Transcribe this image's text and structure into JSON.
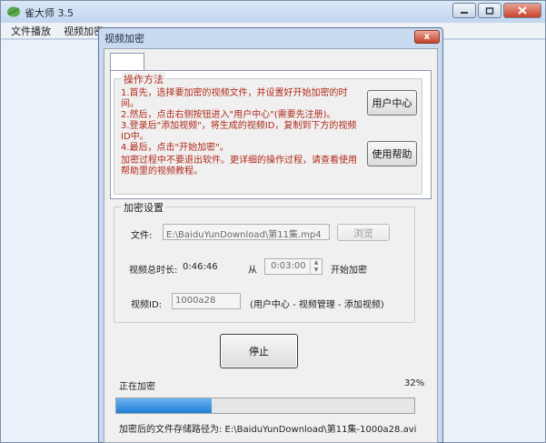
{
  "app": {
    "title": "雀大师 3.5",
    "icon": "leaf-icon",
    "window_buttons": [
      "minimize",
      "maximize",
      "close"
    ]
  },
  "menu": {
    "items": [
      "文件播放",
      "视频加密"
    ]
  },
  "dialog": {
    "title": "视频加密",
    "close_glyph": "x"
  },
  "howto": {
    "title": "操作方法",
    "steps": [
      "1.首先，选择要加密的视频文件，并设置好开始加密的时间。",
      "2.然后，点击右侧按钮进入\"用户中心\"(需要先注册)。",
      "3.登录后\"添加视频\"，将生成的视频ID，复制到下方的视频ID中。",
      "4.最后，点击\"开始加密\"。"
    ],
    "note": "加密过程中不要退出软件。更详细的操作过程，请查看使用帮助里的视频教程。",
    "user_center_label": "用户中心",
    "help_label": "使用帮助"
  },
  "settings": {
    "title": "加密设置",
    "file_label": "文件:",
    "file_value": "E:\\BaiduYunDownload\\第11集.mp4",
    "browse_label": "浏览",
    "duration_label": "视频总时长:",
    "duration_value": "0:46:46",
    "from_label": "从",
    "start_time": "0:03:00",
    "start_label": "开始加密",
    "video_id_label": "视频ID:",
    "video_id_value": "1000a28",
    "video_id_hint": "(用户中心 - 视频管理 - 添加视频)"
  },
  "actions": {
    "stop_label": "停止"
  },
  "status": {
    "label": "正在加密",
    "percent_text": "32%",
    "progress_fraction": 0.32,
    "output_path": "加密后的文件存储路径为: E:\\BaiduYunDownload\\第11集-1000a28.avi"
  },
  "colors": {
    "instruction_red": "#b02a1a",
    "progress_blue": "#1f7fd6"
  }
}
